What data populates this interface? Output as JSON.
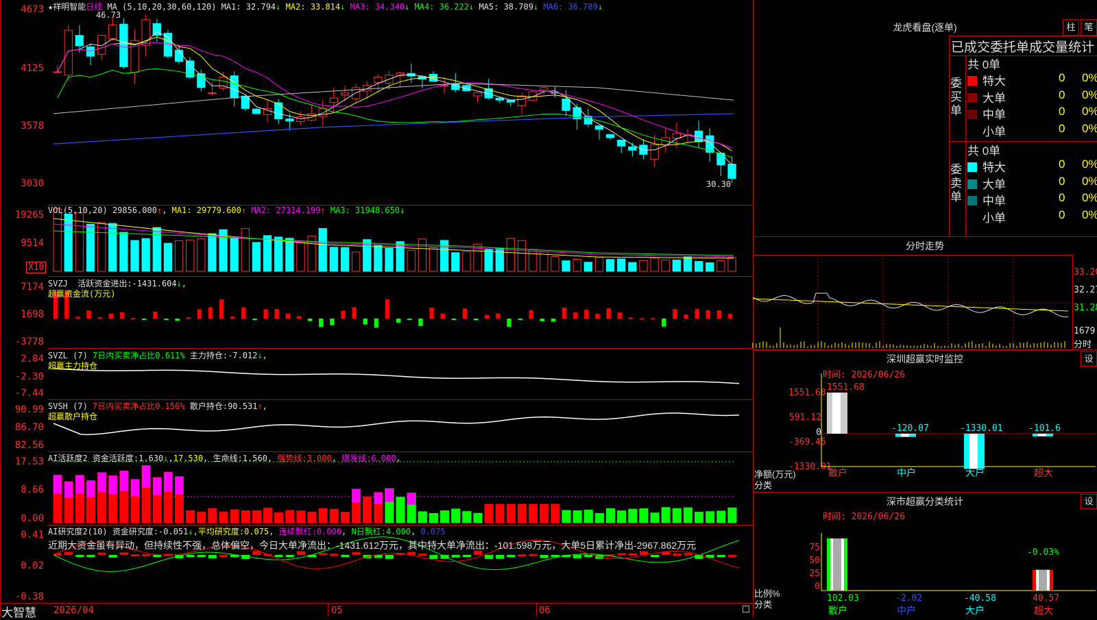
{
  "stock": {
    "name": "祥明智能",
    "period": "日线",
    "star": "★"
  },
  "kline": {
    "header_label": "MA (5,10,20,30,60,120)",
    "ma": [
      {
        "label": "MA1:",
        "value": "32.794",
        "arrow": "↓",
        "color": "#e0e0e0"
      },
      {
        "label": "MA2:",
        "value": "33.814",
        "arrow": "↓",
        "color": "#ffff00"
      },
      {
        "label": "MA3:",
        "value": "34.340",
        "arrow": "↓",
        "color": "#ff00ff"
      },
      {
        "label": "MA4:",
        "value": "36.222",
        "arrow": "↓",
        "color": "#00ff00"
      },
      {
        "label": "MA5:",
        "value": "38.709",
        "arrow": "↓",
        "color": "#e0e0e0"
      },
      {
        "label": "MA6:",
        "value": "36.789",
        "arrow": "↓",
        "color": "#2f4fff"
      }
    ],
    "high_label": "46.73",
    "low_label": "30.30",
    "y_ticks": [
      "4673",
      "4125",
      "3578",
      "3030"
    ]
  },
  "volume": {
    "header": "VOL(5,10,20)",
    "value": "29856.000",
    "arrow": "↑",
    "ma": [
      {
        "label": "MA1:",
        "value": "29779.600",
        "arrow": "↑",
        "color": "#ffff00"
      },
      {
        "label": "MA2:",
        "value": "27314.199",
        "arrow": "↑",
        "color": "#ff00ff"
      },
      {
        "label": "MA3:",
        "value": "31948.650",
        "arrow": "↓",
        "color": "#00ff00"
      }
    ],
    "y_ticks": [
      "19265",
      "9514"
    ],
    "unit": "X10"
  },
  "svzj": {
    "name": "SVZJ",
    "label": "活跃资金进出:",
    "value": "-1431.604",
    "arrow": "↓",
    "sub": "超赢资金流(万元)",
    "y_ticks": [
      "7174",
      "1698",
      "-3778"
    ]
  },
  "svzl": {
    "name": "SVZL (7)",
    "label1": "7日内买卖净占比0.611%",
    "label2": "主力持仓:",
    "value": "-7.012",
    "arrow": "↓",
    "sub": "超赢主力持仓",
    "y_ticks": [
      "2.84",
      "-2.30",
      "-7.44"
    ]
  },
  "svsh": {
    "name": "SVSH (7)",
    "label1": "7日内买卖净占比0.156%",
    "label2": "散户持仓:",
    "value": "90.531",
    "arrow": "↑",
    "sub": "超赢散户持仓",
    "y_ticks": [
      "90.99",
      "86.70",
      "82.56"
    ]
  },
  "ai1": {
    "name": "AI活跃度2",
    "label": "资金活跃度:",
    "value": "1.630",
    "arrow1": "↓",
    "value2": "17.530",
    "label3": "生命线:",
    "value3": "1.560",
    "label4": "强势线:",
    "value4": "3.000",
    "label5": "爆发线:",
    "value5": "6.000",
    "y_ticks": [
      "17.53",
      "8.66",
      "0.00"
    ]
  },
  "ai2": {
    "name": "AI研究度2(10)",
    "label": "资金研究度:",
    "value": "-0.051",
    "arrow": "↓",
    "label2": "平均研究度:",
    "value2": "0.075",
    "label3": "连续飘红:",
    "value3": "0.000",
    "label4": "N日飘红:",
    "value4": "4.000",
    "value5": "0.075",
    "comment": "近期大资金虽有异动，但持续性不强，总体偏空，今日大单净流出：-1431.612万元，其中特大单净流出：-101.598万元，大单5日累计净出-2967.862万元",
    "y_ticks": [
      "0.41",
      "0.02",
      "-0.38"
    ]
  },
  "xaxis": {
    "labels": [
      "2026/04",
      "05",
      "06"
    ],
    "brand": "大智慧"
  },
  "longhu": {
    "title": "龙虎看盘(逐单)",
    "btn1": "柱",
    "btn2": "笔",
    "subtitle": "已成交委托单成交量统计",
    "buy_side": "委买单",
    "sell_side": "委卖单",
    "buy_total": "共 0单",
    "sell_total": "共 0单",
    "buy_rows": [
      {
        "name": "特大",
        "count": "0",
        "pct": "0%",
        "color": "#ff0000"
      },
      {
        "name": "大单",
        "count": "0",
        "pct": "0%",
        "color": "#8b0000"
      },
      {
        "name": "中单",
        "count": "0",
        "pct": "0%",
        "color": "#6b0000"
      },
      {
        "name": "小单",
        "count": "0",
        "pct": "0%",
        "color": "#000000"
      }
    ],
    "sell_rows": [
      {
        "name": "特大",
        "count": "0",
        "pct": "0%",
        "color": "#00ffff"
      },
      {
        "name": "大单",
        "count": "0",
        "pct": "0%",
        "color": "#008b8b"
      },
      {
        "name": "中单",
        "count": "0",
        "pct": "0%",
        "color": "#007777"
      },
      {
        "name": "小单",
        "count": "0",
        "pct": "0%",
        "color": "#000000"
      }
    ]
  },
  "intraday": {
    "title": "分时走势",
    "y_ticks": [
      "33.20",
      "32.27",
      "31.28",
      "1679",
      "分时"
    ]
  },
  "monitor": {
    "title": "深圳超赢实时监控",
    "btn": "设",
    "time": "时间: 2026/06/26",
    "y_ticks": [
      "1551.68",
      "591.12",
      "0",
      "-369.45",
      "-1330.01"
    ],
    "axis_title": "净额(万元)",
    "cat_title": "分类",
    "cats": [
      "散户",
      "中户",
      "大户",
      "超大"
    ],
    "values": [
      1551.68,
      -120.07,
      -1330.01,
      -101.6
    ],
    "value_labels": [
      "1551.68",
      "-120.07",
      "-1330.01",
      "-101.6"
    ]
  },
  "classify": {
    "title": "深市超赢分类统计",
    "btn": "设",
    "time": "时间: 2026/06/26",
    "y_ticks": [
      "75",
      "50",
      "25",
      "0"
    ],
    "axis_title": "比例%",
    "cat_title": "分类",
    "cats": [
      "散户",
      "中户",
      "大户",
      "超大"
    ],
    "values": [
      102.03,
      -2.02,
      -40.58,
      40.57
    ],
    "top_label": "-0.03%",
    "value_labels": [
      "102.03",
      "-2.02",
      "-40.58",
      "40.57"
    ]
  }
}
